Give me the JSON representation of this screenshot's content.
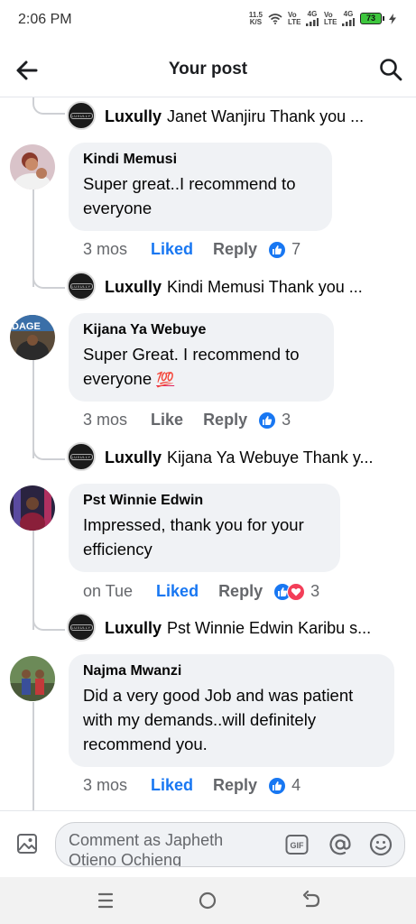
{
  "status": {
    "time": "2:06 PM",
    "net_speed_value": "11.5",
    "net_speed_unit": "K/S",
    "sim1": "Vo LTE",
    "sim1_type": "4G",
    "sim2": "Vo LTE",
    "sim2_type": "4G",
    "battery": "73"
  },
  "header": {
    "title": "Your post"
  },
  "thread": [
    {
      "type": "reply",
      "author": "Luxully",
      "text": "Janet Wanjiru Thank you ..."
    },
    {
      "type": "comment",
      "author": "Kindi Memusi",
      "text": "Super great..I recommend to everyone",
      "time": "3 mos",
      "like_label": "Liked",
      "liked": true,
      "reply_label": "Reply",
      "reactions": [
        "like"
      ],
      "count": "7"
    },
    {
      "type": "reply",
      "author": "Luxully",
      "text": "Kindi Memusi Thank you ..."
    },
    {
      "type": "comment",
      "author": "Kijana Ya Webuye",
      "text": "Super Great. I recommend to everyone",
      "emoji": "💯",
      "time": "3 mos",
      "like_label": "Like",
      "liked": false,
      "reply_label": "Reply",
      "reactions": [
        "like"
      ],
      "count": "3"
    },
    {
      "type": "reply",
      "author": "Luxully",
      "text": "Kijana Ya Webuye Thank y..."
    },
    {
      "type": "comment",
      "author": "Pst Winnie Edwin",
      "text": "Impressed, thank you for your efficiency",
      "time": "on Tue",
      "like_label": "Liked",
      "liked": true,
      "reply_label": "Reply",
      "reactions": [
        "like",
        "love"
      ],
      "count": "3"
    },
    {
      "type": "reply",
      "author": "Luxully",
      "text": "Pst Winnie Edwin Karibu s..."
    },
    {
      "type": "comment",
      "author": "Najma Mwanzi",
      "text": "Did a very good Job and was patient with my demands..will definitely recommend you.",
      "time": "3 mos",
      "like_label": "Liked",
      "liked": true,
      "reply_label": "Reply",
      "reactions": [
        "like"
      ],
      "count": "4"
    }
  ],
  "page_logo_text": "LUXULLY",
  "composer": {
    "placeholder": "Comment as Japheth Otieno Ochieng",
    "gif_label": "GIF"
  },
  "colors": {
    "accent": "#1877f2",
    "love": "#f33e58",
    "bubble": "#f0f2f5",
    "muted": "#65676b"
  },
  "icons": {
    "back": "arrow-left-icon",
    "search": "search-icon",
    "photo": "photo-icon",
    "gif": "gif-icon",
    "mention": "at-icon",
    "emoji": "emoji-icon",
    "nav_recents": "menu-icon",
    "nav_home": "home-circle-icon",
    "nav_back": "back-nav-icon"
  }
}
